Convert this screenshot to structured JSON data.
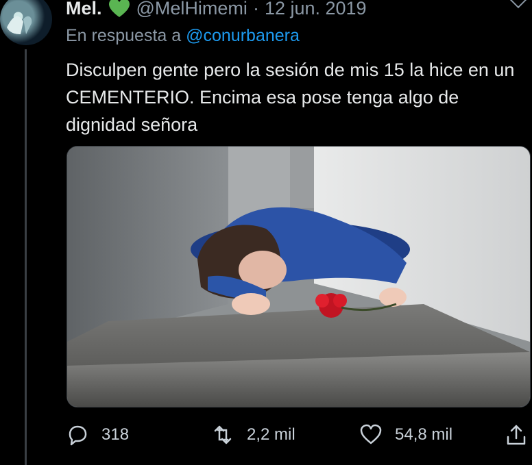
{
  "tweet": {
    "display_name": "Mel.",
    "handle": "@MelHimemi",
    "separator": "·",
    "date": "12 jun. 2019",
    "reply_prefix": "En respuesta a",
    "reply_mention": "@conurbanera",
    "text": "Disculpen gente pero la sesión de mis 15 la hice en un CEMENTERIO. Encima esa pose tenga algo de dignidad señora",
    "badge_icon": "green-heart-icon",
    "media_icon": "photo-grave-cemetery",
    "actions": {
      "replies": "318",
      "retweets": "2,2 mil",
      "likes": "54,8 mil"
    }
  },
  "colors": {
    "background": "#000000",
    "text": "#e7e9ea",
    "muted": "#8b98a5",
    "link": "#1d9bf0",
    "badge_heart": "#5ab552"
  }
}
